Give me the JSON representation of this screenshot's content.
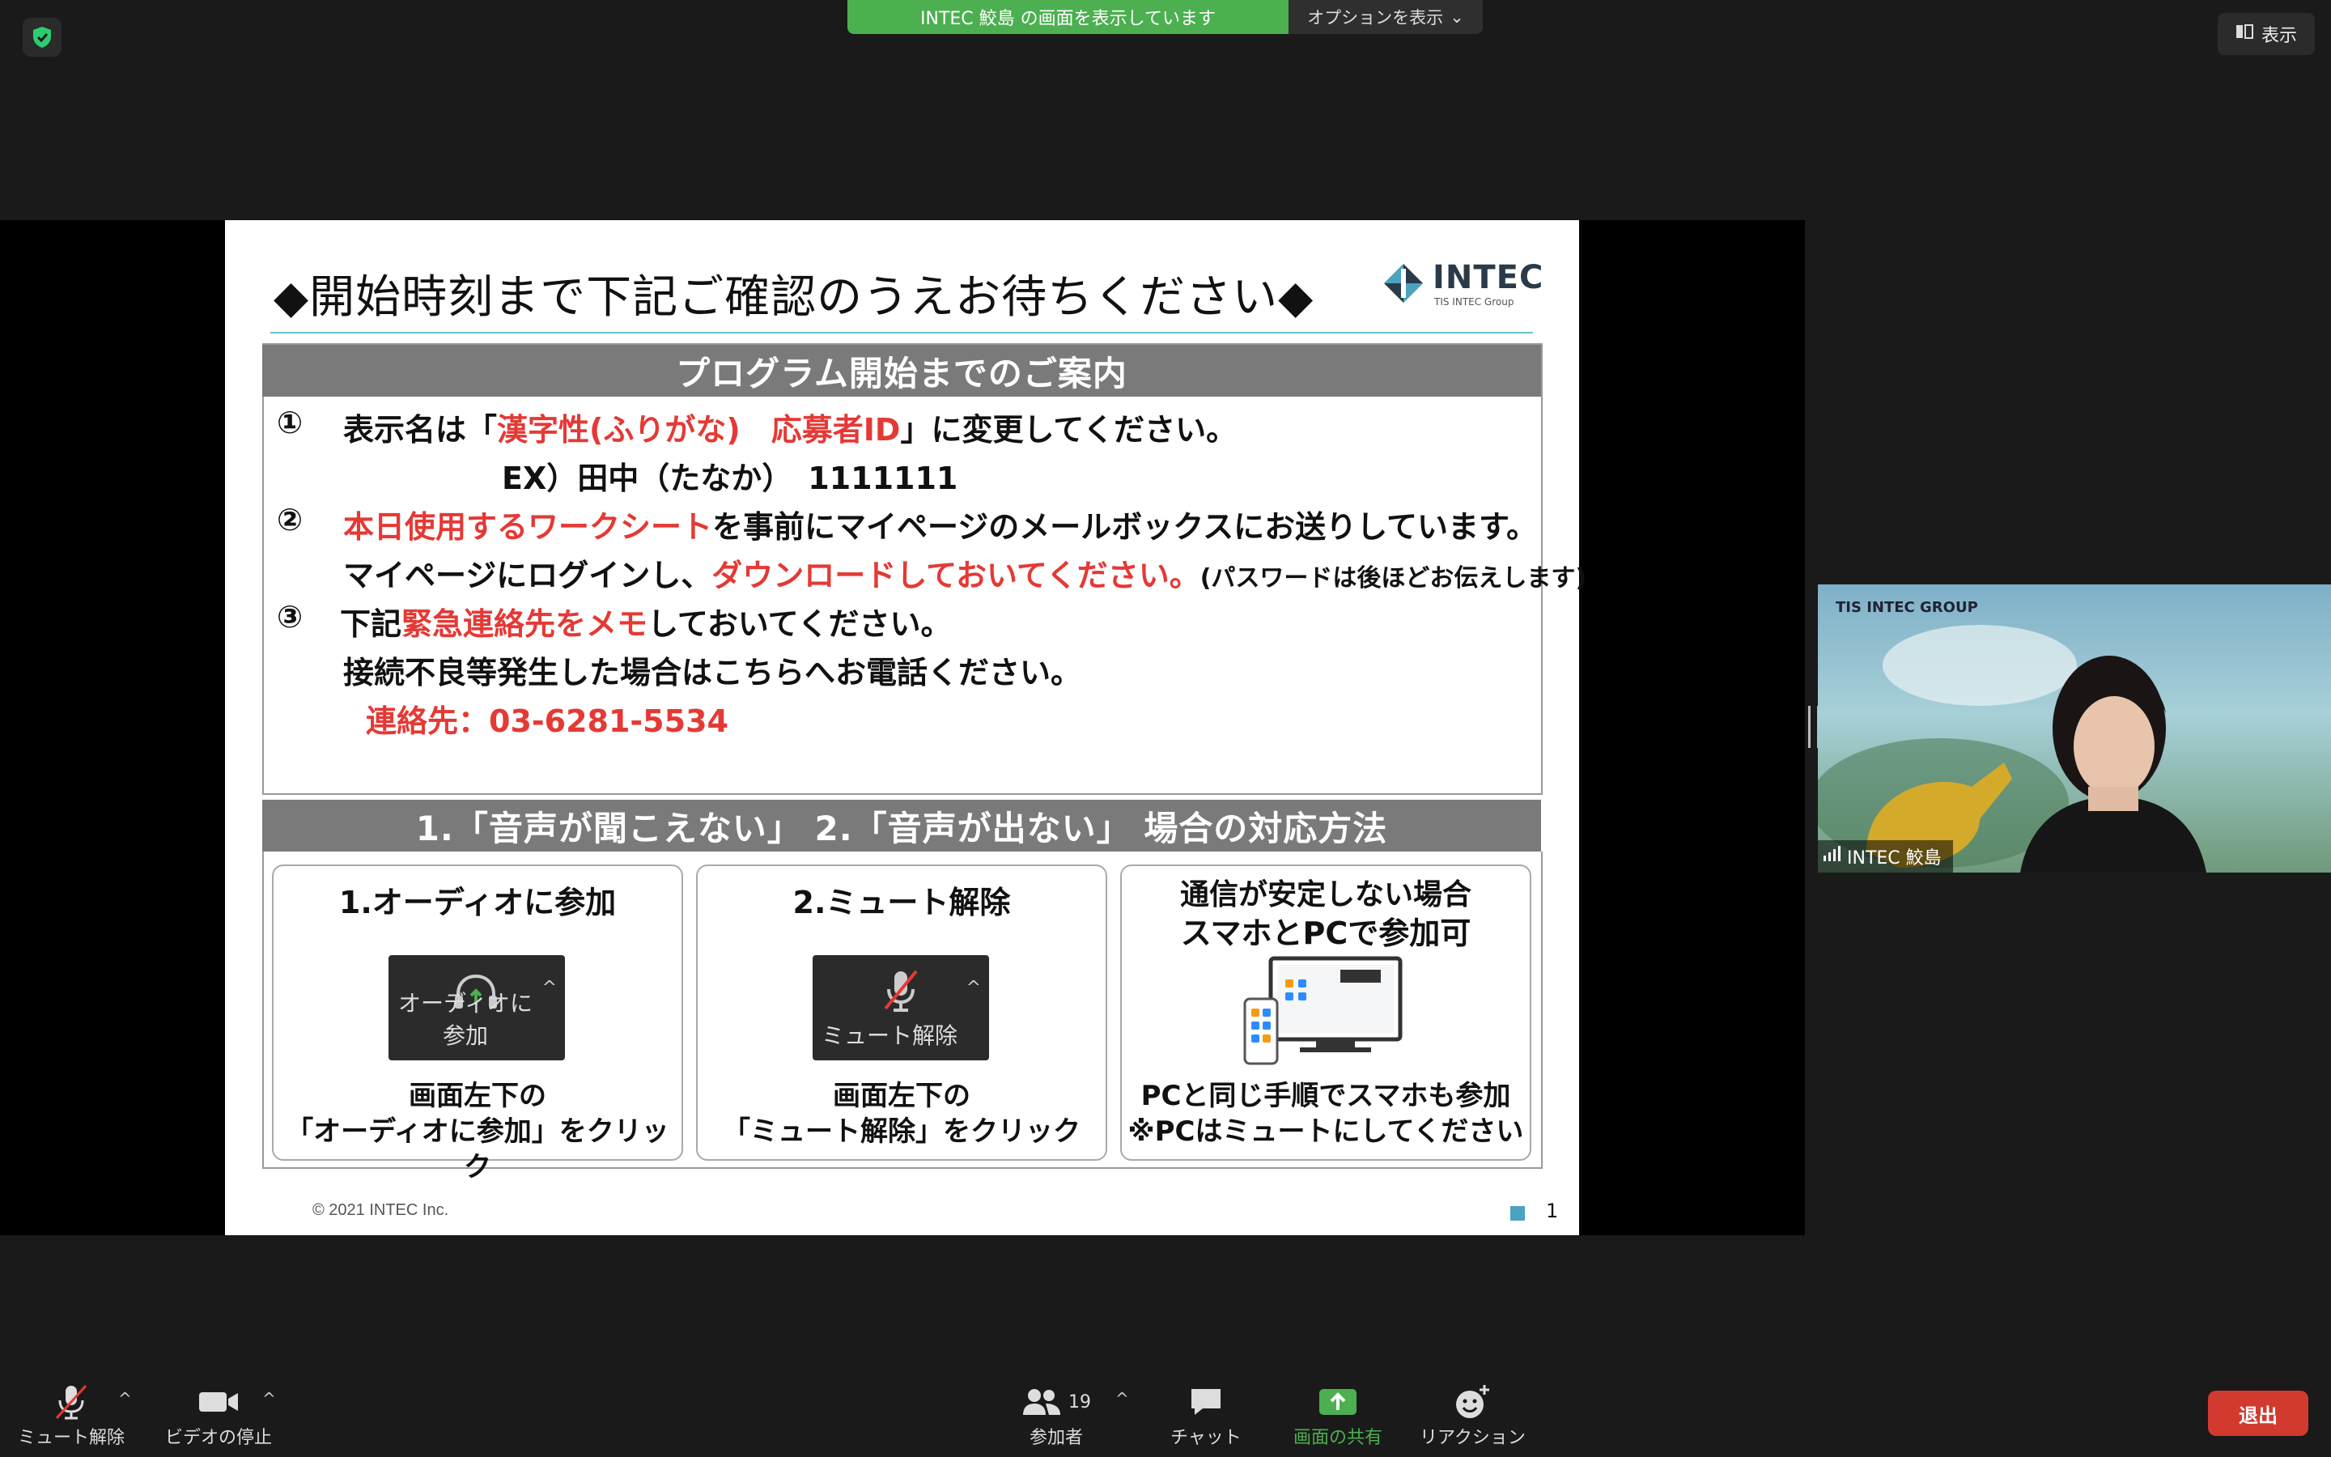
{
  "top": {
    "share_banner": "INTEC 鮫島 の画面を表示しています",
    "options_label": "オプションを表示",
    "view_label": "表示"
  },
  "slide": {
    "title": "◆開始時刻まで下記ご確認のうえお待ちください◆",
    "logo_name": "INTEC",
    "logo_sub": "TIS INTEC Group",
    "section1_heading": "プログラム開始までのご案内",
    "item1": {
      "num": "①",
      "pre": "表示名は「",
      "red": "漢字性(ふりがな)　応募者ID",
      "post": "」に変更してください。",
      "example": "EX）田中（たなか）　1111111"
    },
    "item2": {
      "num": "②",
      "red": "本日使用するワークシート",
      "post": "を事前にマイページのメールボックスにお送りしています。",
      "line2_pre": "マイページにログインし、",
      "line2_red": "ダウンロードしておいてください。",
      "line2_small": "(パスワードは後ほどお伝えします)"
    },
    "item3": {
      "num": "③",
      "pre": "下記",
      "red": "緊急連絡先をメモ",
      "post": "しておいてください。",
      "line2": "接続不良等発生した場合はこちらへお電話ください。",
      "contact": "連絡先：03-6281-5534"
    },
    "section2_heading": "1.「音声が聞こえない」 2.「音声が出ない」 場合の対応方法",
    "cards": [
      {
        "title": "1.オーディオに参加",
        "button_label": "オーディオに参加",
        "desc1": "画面左下の",
        "desc2": "「オーディオに参加」をクリック"
      },
      {
        "title": "2.ミュート解除",
        "button_label": "ミュート解除",
        "desc1": "画面左下の",
        "desc2": "「ミュート解除」をクリック"
      },
      {
        "title1": "通信が安定しない場合",
        "title2": "スマホとPCで参加可",
        "desc1": "PCと同じ手順でスマホも参加",
        "desc2": "※PCはミュートにしてください"
      }
    ],
    "copyright": "© 2021 INTEC Inc.",
    "page_number": "1"
  },
  "video": {
    "brand": "TIS INTEC GROUP",
    "name": "INTEC 鮫島"
  },
  "toolbar": {
    "unmute": "ミュート解除",
    "stop_video": "ビデオの停止",
    "participants": "参加者",
    "participant_count": "19",
    "chat": "チャット",
    "share": "画面の共有",
    "reactions": "リアクション",
    "leave": "退出"
  },
  "colors": {
    "share_green": "#4caf50",
    "accent_red": "#e53935",
    "leave_red": "#d23a2f"
  }
}
